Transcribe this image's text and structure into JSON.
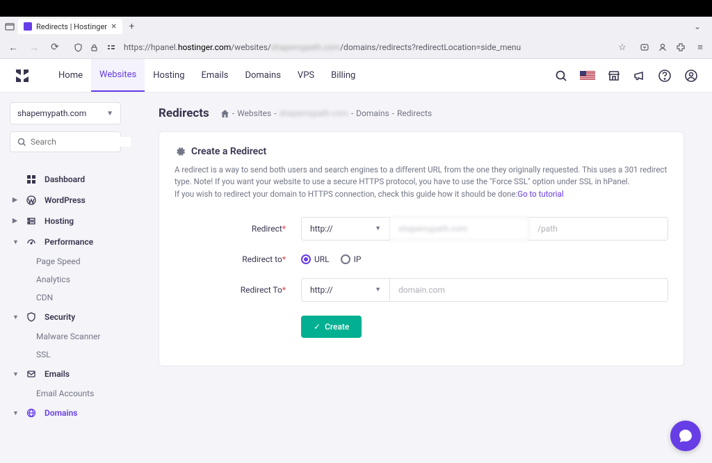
{
  "browser": {
    "tab_title": "Redirects | Hostinger",
    "url_prefix": "https://hpanel.",
    "url_host": "hostinger.com",
    "url_path": "/websites/",
    "url_blur": "shapemypath.com",
    "url_suffix": "/domains/redirects?redirectLocation=side_menu"
  },
  "nav": {
    "items": [
      "Home",
      "Websites",
      "Hosting",
      "Emails",
      "Domains",
      "VPS",
      "Billing"
    ],
    "active": "Websites"
  },
  "sidebar": {
    "site": "shapemypath.com",
    "search_placeholder": "Search",
    "dashboard": "Dashboard",
    "wordpress": "WordPress",
    "hosting": "Hosting",
    "performance": "Performance",
    "perf_items": [
      "Page Speed",
      "Analytics",
      "CDN"
    ],
    "security": "Security",
    "sec_items": [
      "Malware Scanner",
      "SSL"
    ],
    "emails": "Emails",
    "email_items": [
      "Email Accounts"
    ],
    "domains": "Domains"
  },
  "page": {
    "title": "Redirects",
    "crumb_websites": "Websites",
    "crumb_blur": "shapemypath.com",
    "crumb_domains": "Domains",
    "crumb_redirects": "Redirects"
  },
  "card": {
    "title": "Create a Redirect",
    "desc1": "A redirect is a way to send both users and search engines to a different URL from the one they originally requested. This uses a 301 redirect type. Note! If you want your website to use a secure HTTPS protocol, you have to use the \"Force SSL\" option under SSL in hPanel.",
    "desc2": "If you wish to redirect your domain to HTTPS connection, check this guide how it should be done:",
    "link": "Go to tutorial"
  },
  "form": {
    "redirect_label": "Redirect",
    "protocol": "http://",
    "domain_blur": "shapemypath.com",
    "path_placeholder": "/path",
    "redirect_to_type_label": "Redirect to",
    "url_option": "URL",
    "ip_option": "IP",
    "redirect_to_label": "Redirect To",
    "protocol2": "http://",
    "domain_placeholder": "domain.com",
    "create_btn": "Create"
  }
}
